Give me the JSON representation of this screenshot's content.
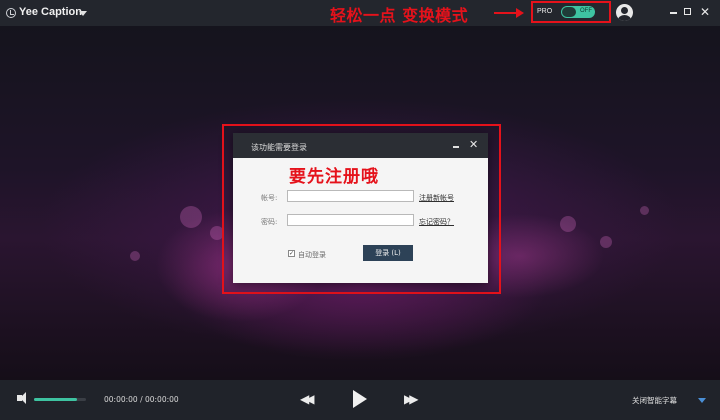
{
  "app": {
    "title": "Yee Caption"
  },
  "header": {
    "annotation": "轻松一点 变换模式",
    "pro_label": "PRO",
    "pro_toggle_state": "OFF"
  },
  "dialog": {
    "title": "该功能需要登录",
    "annotation": "要先注册哦",
    "account_label": "帐号:",
    "account_value": "",
    "register_link": "注册新帐号",
    "password_label": "密码:",
    "password_value": "",
    "forgot_link": "忘记密码？",
    "auto_login_label": "自动登录",
    "auto_login_checked": true,
    "login_button": "登录 (L)",
    "close_glyph": "✕"
  },
  "player": {
    "time": "00:00:00 / 00:00:00",
    "volume_level": 0.82,
    "subtitle_toggle": "关闭智能字幕"
  },
  "colors": {
    "accent": "#3ec3a1",
    "annotation": "#e5121b",
    "button": "#2d4257"
  }
}
